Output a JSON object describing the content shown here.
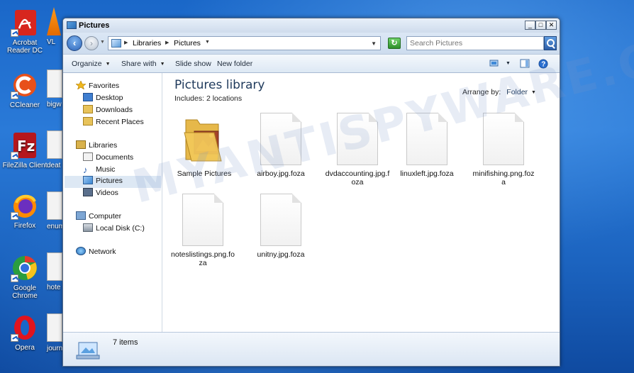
{
  "desktop": {
    "icons": [
      {
        "label_line1": "Acrobat",
        "label_line2": "Reader DC",
        "color": "#d7261e"
      },
      {
        "label_line1": "CCleaner",
        "label_line2": "",
        "color": "#e8501a"
      },
      {
        "label_line1": "FileZilla Client",
        "label_line2": "",
        "color": "#b5171c"
      },
      {
        "label_line1": "Firefox",
        "label_line2": "",
        "color": "#ff8a00"
      },
      {
        "label_line1": "Google",
        "label_line2": "Chrome",
        "color": "#2a9d3f"
      },
      {
        "label_line1": "Opera",
        "label_line2": "",
        "color": "#e0141e"
      }
    ],
    "partial_labels": [
      "VL",
      "bigw",
      "deat",
      "enum",
      "hote",
      "journ"
    ]
  },
  "watermark": "MYANTISPYWARE.COM",
  "window": {
    "title": "Pictures",
    "controls": {
      "minimize": "_",
      "maximize": "□",
      "close": "✕"
    },
    "address": {
      "crumbs": [
        "Libraries",
        "Pictures"
      ],
      "search_placeholder": "Search Pictures"
    },
    "toolbar": {
      "organize": "Organize",
      "share_with": "Share with",
      "slide_show": "Slide show",
      "new_folder": "New folder"
    },
    "nav": {
      "favorites": "Favorites",
      "desktop": "Desktop",
      "downloads": "Downloads",
      "recent_places": "Recent Places",
      "libraries": "Libraries",
      "documents": "Documents",
      "music": "Music",
      "pictures": "Pictures",
      "videos": "Videos",
      "computer": "Computer",
      "local_disk": "Local Disk (C:)",
      "network": "Network",
      "selected": "Pictures"
    },
    "main": {
      "title": "Pictures library",
      "includes": "Includes:  2 locations",
      "arrange_label": "Arrange by:",
      "arrange_value": "Folder"
    },
    "files": [
      {
        "name": "Sample Pictures",
        "type": "folder"
      },
      {
        "name": "airboy.jpg.foza",
        "type": "file"
      },
      {
        "name": "dvdaccounting.jpg.foza",
        "type": "file"
      },
      {
        "name": "linuxleft.jpg.foza",
        "type": "file"
      },
      {
        "name": "minifishing.png.foza",
        "type": "file"
      },
      {
        "name": "noteslistings.png.foza",
        "type": "file"
      },
      {
        "name": "unitny.jpg.foza",
        "type": "file"
      }
    ],
    "status": {
      "count": "7 items"
    }
  }
}
